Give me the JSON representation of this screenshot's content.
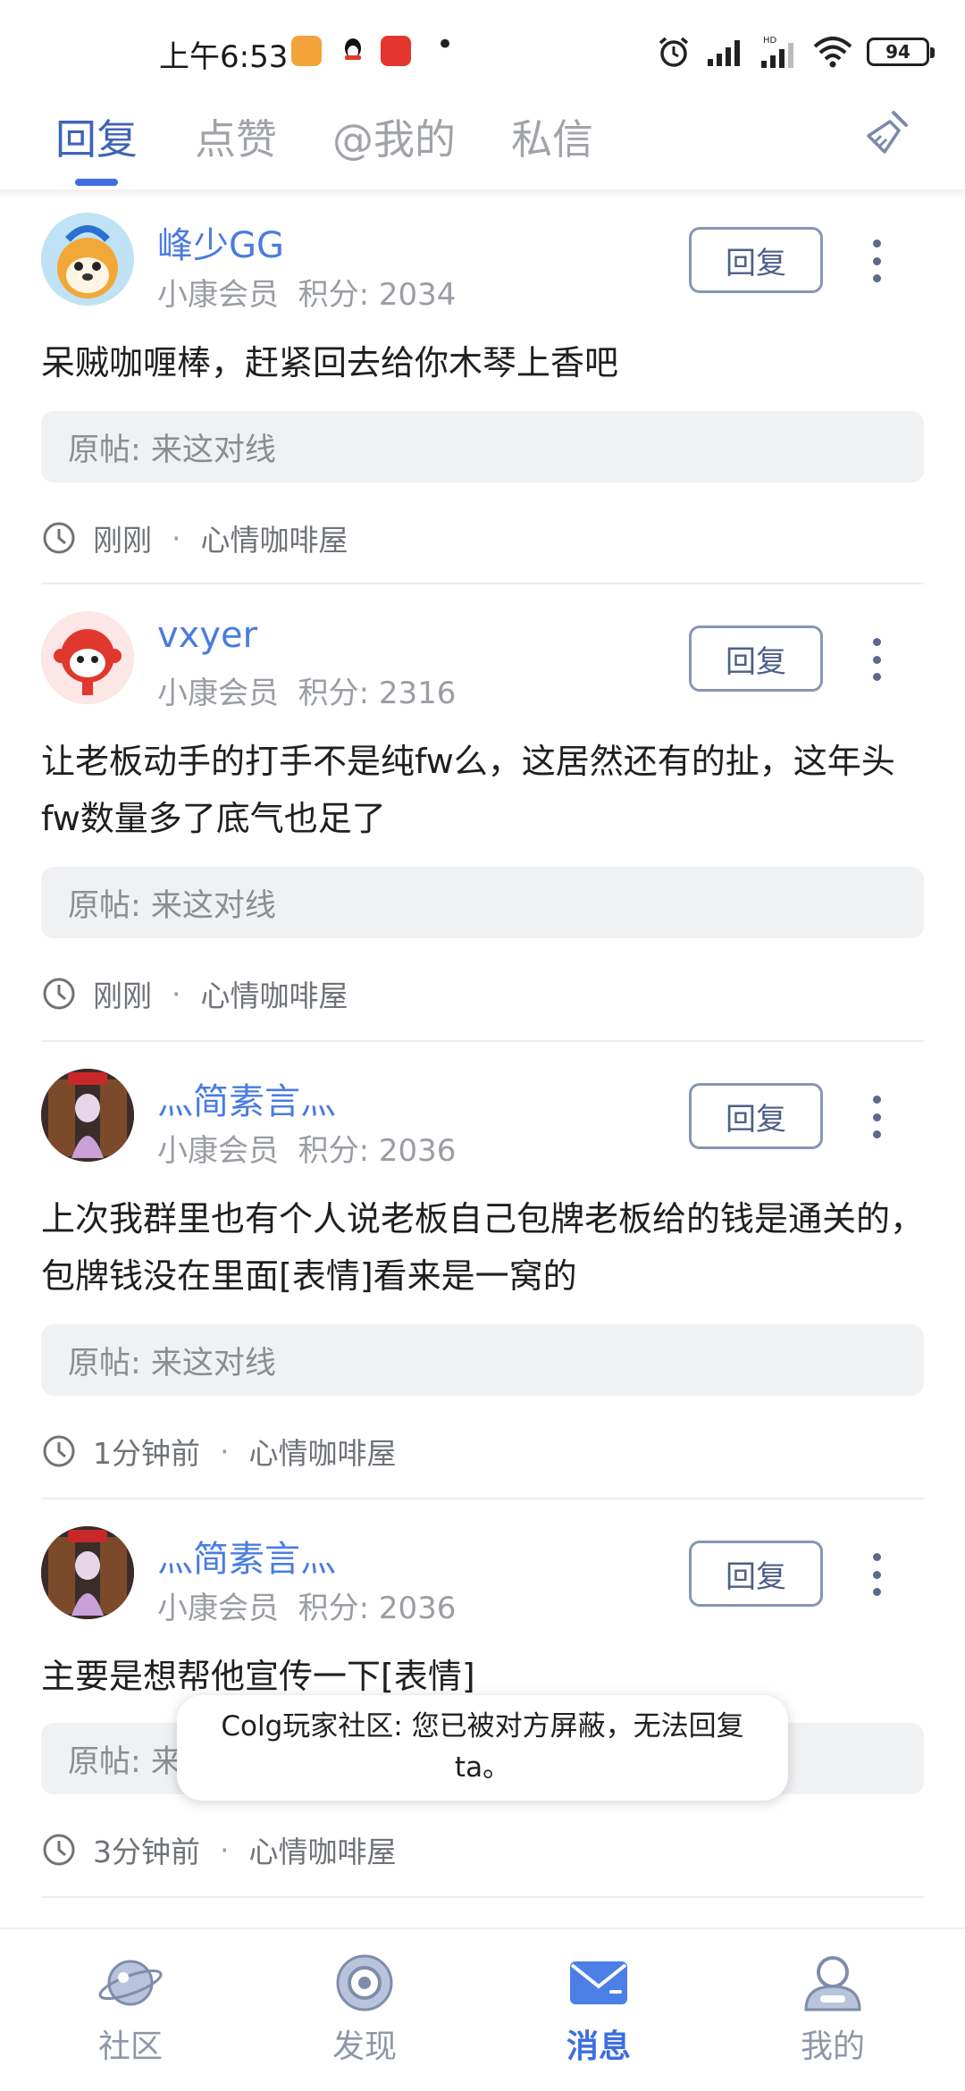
{
  "status_bar": {
    "time": "上午6:53",
    "battery": "94"
  },
  "tabs": [
    {
      "label": "回复",
      "active": true
    },
    {
      "label": "点赞",
      "active": false
    },
    {
      "label": "@我的",
      "active": false
    },
    {
      "label": "私信",
      "active": false
    }
  ],
  "posts": [
    {
      "username": "峰少GG",
      "level": "小康会员",
      "score_label": "积分: 2034",
      "reply_label": "回复",
      "content": "呆贼咖喱棒，赶紧回去给你木琴上香吧",
      "original": "原帖: 来这对线",
      "time": "刚刚",
      "forum": "心情咖啡屋"
    },
    {
      "username": "vxyer",
      "level": "小康会员",
      "score_label": "积分: 2316",
      "reply_label": "回复",
      "content": "让老板动手的打手不是纯fw么，这居然还有的扯，这年头fw数量多了底气也足了",
      "original": "原帖: 来这对线",
      "time": "刚刚",
      "forum": "心情咖啡屋"
    },
    {
      "username": "灬简素言灬",
      "level": "小康会员",
      "score_label": "积分: 2036",
      "reply_label": "回复",
      "content": "上次我群里也有个人说老板自己包牌老板给的钱是通关的，包牌钱没在里面[表情]看来是一窝的",
      "original": "原帖: 来这对线",
      "time": "1分钟前",
      "forum": "心情咖啡屋"
    },
    {
      "username": "灬简素言灬",
      "level": "小康会员",
      "score_label": "积分: 2036",
      "reply_label": "回复",
      "content": "主要是想帮他宣传一下[表情]",
      "original": "原帖: 来这对线",
      "time": "3分钟前",
      "forum": "心情咖啡屋"
    }
  ],
  "separator": "·",
  "toast": "Colg玩家社区: 您已被对方屏蔽，无法回复ta。",
  "bottom_nav": [
    {
      "label": "社区",
      "icon": "planet-icon",
      "active": false
    },
    {
      "label": "发现",
      "icon": "discover-icon",
      "active": false
    },
    {
      "label": "消息",
      "icon": "mail-icon",
      "active": true
    },
    {
      "label": "我的",
      "icon": "profile-icon",
      "active": false
    }
  ],
  "colors": {
    "accent": "#3d6ee0",
    "username": "#4a7ce0",
    "muted": "#9a9da3"
  }
}
